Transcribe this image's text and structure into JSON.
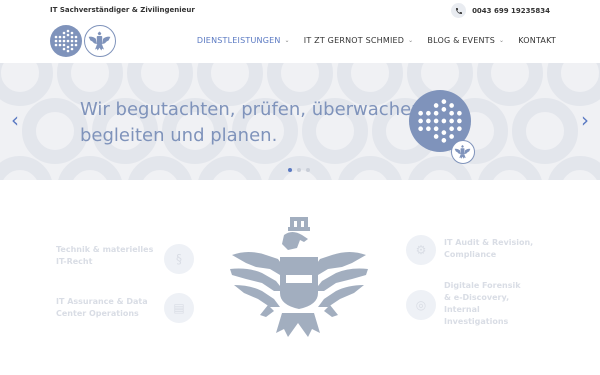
{
  "topbar": {
    "title": "IT Sachverständiger & Zivilingenieur",
    "phone": "0043 699 19235834",
    "phone_icon": "phone-icon"
  },
  "nav": {
    "items": [
      {
        "label": "DIENSTLEISTUNGEN",
        "has_dropdown": true,
        "active": true
      },
      {
        "label": "IT ZT GERNOT SCHMIED",
        "has_dropdown": true,
        "active": false
      },
      {
        "label": "BLOG & EVENTS",
        "has_dropdown": true,
        "active": false
      },
      {
        "label": "KONTAKT",
        "has_dropdown": false,
        "active": false
      }
    ]
  },
  "hero": {
    "line1": "Wir begutachten, prüfen, überwachen,",
    "line2": "begleiten und planen.",
    "slide_count": 3,
    "active_slide": 1
  },
  "services": {
    "left_top": [
      "Technik & materielles",
      "IT-Recht"
    ],
    "left_bottom": [
      "IT Assurance & Data",
      "Center Operations"
    ],
    "right_top": [
      "IT Audit & Revision,",
      "Compliance"
    ],
    "right_bottom": [
      "Digitale Forensik",
      "& e-Discovery,",
      "Internal",
      "Investigations"
    ]
  },
  "colors": {
    "accent": "#5a79c2",
    "logo": "#7f93bb",
    "eagle": "#a2aebf"
  }
}
